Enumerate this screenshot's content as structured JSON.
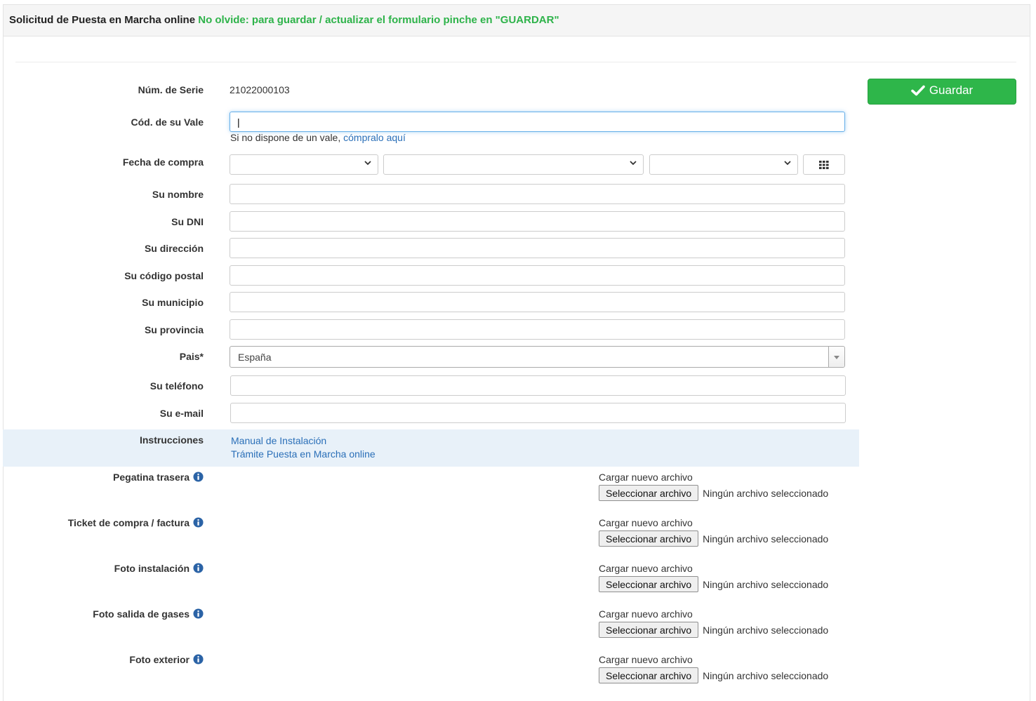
{
  "header": {
    "title": "Solicitud de Puesta en Marcha online",
    "notice": "No olvide: para guardar / actualizar el formulario pinche en \"GUARDAR\""
  },
  "save_button": {
    "label": "Guardar",
    "icon": "check-icon",
    "color": "#2eb64a"
  },
  "form": {
    "serial_label": "Núm. de Serie",
    "serial_value": "21022000103",
    "voucher_label": "Cód. de su Vale",
    "voucher_value": "|",
    "voucher_help": "Si no dispone de un vale,",
    "voucher_link": "cómpralo aquí",
    "purchase_date_label": "Fecha de compra",
    "name_label": "Su nombre",
    "dni_label": "Su DNI",
    "address_label": "Su dirección",
    "postal_label": "Su código postal",
    "municipality_label": "Su municipio",
    "province_label": "Su provincia",
    "country_label": "Pais*",
    "country_value": "España",
    "phone_label": "Su teléfono",
    "email_label": "Su e-mail"
  },
  "instructions": {
    "label": "Instrucciones",
    "links": [
      "Manual de Instalación",
      "Trámite Puesta en Marcha online"
    ]
  },
  "uploads": {
    "caption": "Cargar nuevo archivo",
    "button_label": "Seleccionar archivo",
    "status": "Ningún archivo seleccionado",
    "items": [
      "Pegatina trasera",
      "Ticket de compra / factura",
      "Foto instalación",
      "Foto salida de gases",
      "Foto exterior"
    ]
  }
}
